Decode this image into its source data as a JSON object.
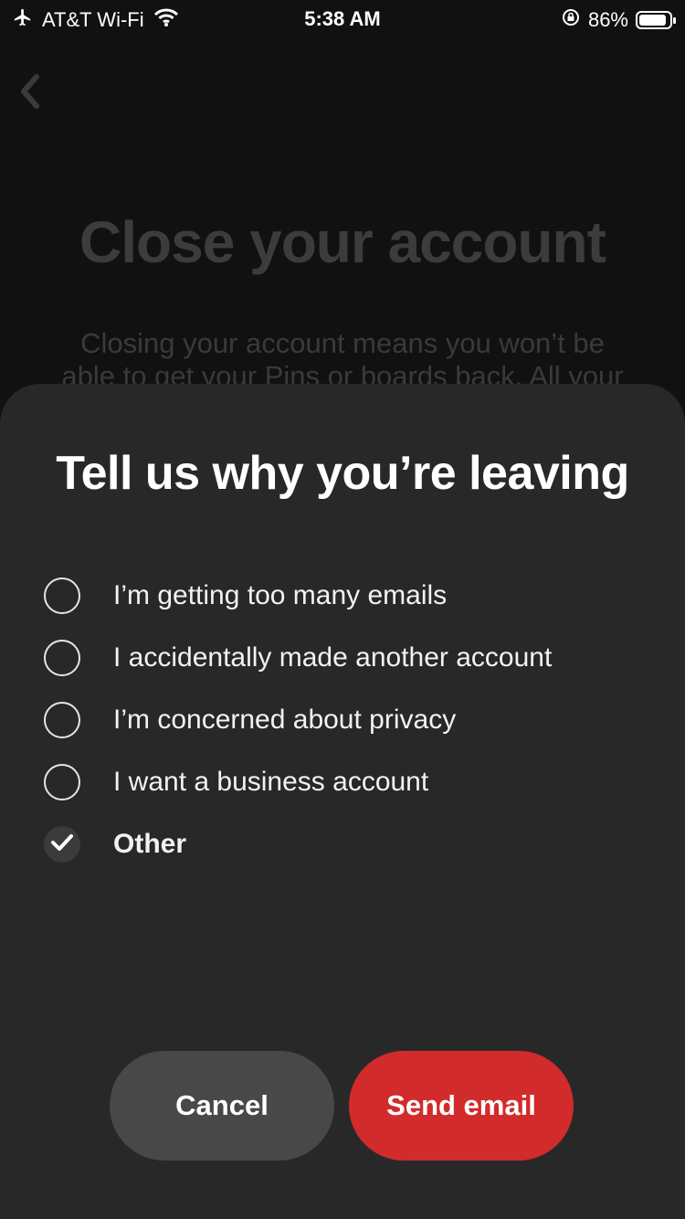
{
  "status_bar": {
    "carrier": "AT&T Wi-Fi",
    "time": "5:38 AM",
    "battery": "86%"
  },
  "background": {
    "title": "Close your account",
    "body_line1": "Closing your account means you won’t be",
    "body_line2": "able to get your Pins or boards back. All your"
  },
  "sheet": {
    "title": "Tell us why you’re leaving",
    "options": [
      {
        "label": "I’m getting too many emails",
        "selected": false
      },
      {
        "label": "I accidentally made another account",
        "selected": false
      },
      {
        "label": "I’m concerned about privacy",
        "selected": false
      },
      {
        "label": "I want a business account",
        "selected": false
      },
      {
        "label": "Other",
        "selected": true
      }
    ],
    "cancel_label": "Cancel",
    "send_label": "Send email"
  },
  "colors": {
    "sheet_bg": "#282828",
    "accent_red": "#d22b2b",
    "cancel_bg": "#484848"
  },
  "icons": [
    "airplane-icon",
    "wifi-icon",
    "rotation-lock-icon",
    "battery-icon",
    "back-chevron-icon",
    "checkmark-icon"
  ]
}
